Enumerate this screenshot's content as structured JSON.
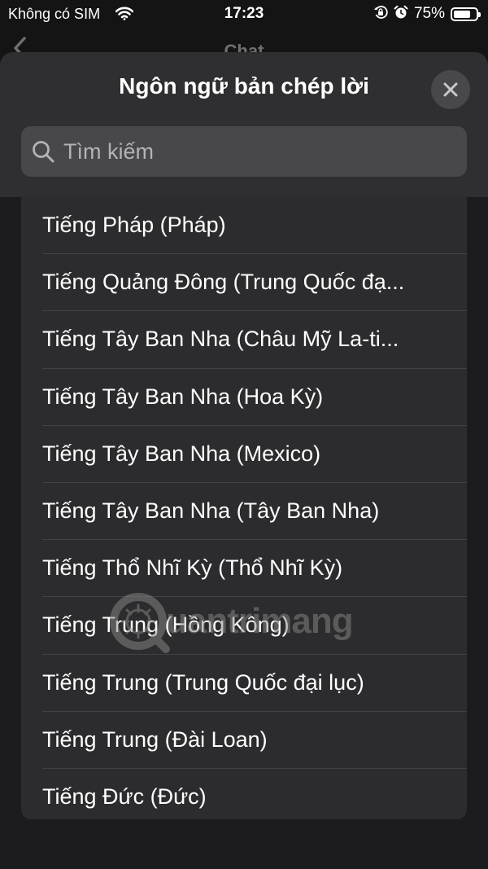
{
  "status_bar": {
    "carrier": "Không có SIM",
    "time": "17:23",
    "battery": "75%",
    "battery_level": 0.75,
    "icons": [
      "wifi-icon",
      "orientation-lock-icon",
      "alarm-icon",
      "battery-icon"
    ]
  },
  "background_nav": {
    "title": "Chat",
    "back_icon": "chevron-left-icon"
  },
  "sheet": {
    "title": "Ngôn ngữ bản chép lời",
    "close_icon": "close-icon",
    "search": {
      "placeholder": "Tìm kiếm",
      "value": "",
      "icon": "search-icon"
    },
    "languages": [
      "Tiếng Pháp (Pháp)",
      "Tiếng Quảng Đông (Trung Quốc đạ...",
      "Tiếng Tây Ban Nha (Châu Mỹ La-ti...",
      "Tiếng Tây Ban Nha (Hoa Kỳ)",
      "Tiếng Tây Ban Nha (Mexico)",
      "Tiếng Tây Ban Nha (Tây Ban Nha)",
      "Tiếng Thổ Nhĩ Kỳ (Thổ Nhĩ Kỳ)",
      "Tiếng Trung (Hồng Kông)",
      "Tiếng Trung (Trung Quốc đại lục)",
      "Tiếng Trung (Đài Loan)",
      "Tiếng Đức (Đức)"
    ]
  },
  "watermark": {
    "text": "uantrimang",
    "icon": "quantrimang-logo-icon"
  },
  "colors": {
    "sheet_header": "#2f2f31",
    "list_background": "#2c2c2e",
    "search_field": "#48484a",
    "close_button": "#48484b",
    "separator": "#424246",
    "text": "#ffffff",
    "placeholder": "#b3b3b7"
  }
}
